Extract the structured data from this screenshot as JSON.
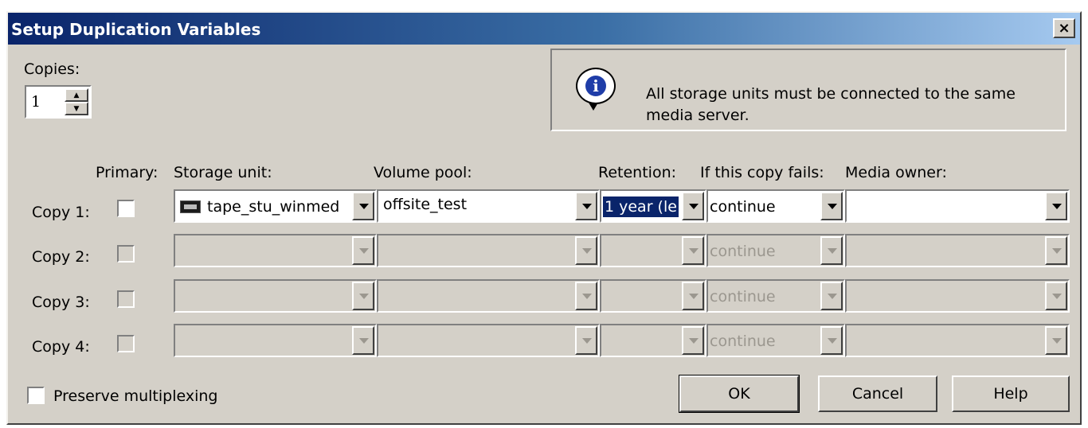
{
  "window": {
    "title": "Setup Duplication Variables",
    "close_label": "×"
  },
  "copies": {
    "label": "Copies:",
    "value": "1"
  },
  "info": {
    "icon": "info-icon",
    "text": "All storage units must be connected to the same media server."
  },
  "columns": {
    "primary": "Primary:",
    "storage_unit": "Storage unit:",
    "volume_pool": "Volume pool:",
    "retention": "Retention:",
    "if_fails": "If this copy fails:",
    "media_owner": "Media owner:"
  },
  "rows": [
    {
      "label": "Copy 1:",
      "storage_unit": "tape_stu_winmed",
      "volume_pool": "offsite_test",
      "retention": "1 year (le",
      "if_fails": "continue",
      "media_owner": ""
    },
    {
      "label": "Copy 2:",
      "storage_unit": "",
      "volume_pool": "",
      "retention": "",
      "if_fails": "continue",
      "media_owner": ""
    },
    {
      "label": "Copy 3:",
      "storage_unit": "",
      "volume_pool": "",
      "retention": "",
      "if_fails": "continue",
      "media_owner": ""
    },
    {
      "label": "Copy 4:",
      "storage_unit": "",
      "volume_pool": "",
      "retention": "",
      "if_fails": "continue",
      "media_owner": ""
    }
  ],
  "preserve_multiplexing": {
    "label": "Preserve multiplexing",
    "checked": false
  },
  "buttons": {
    "ok": "OK",
    "cancel": "Cancel",
    "help": "Help"
  }
}
